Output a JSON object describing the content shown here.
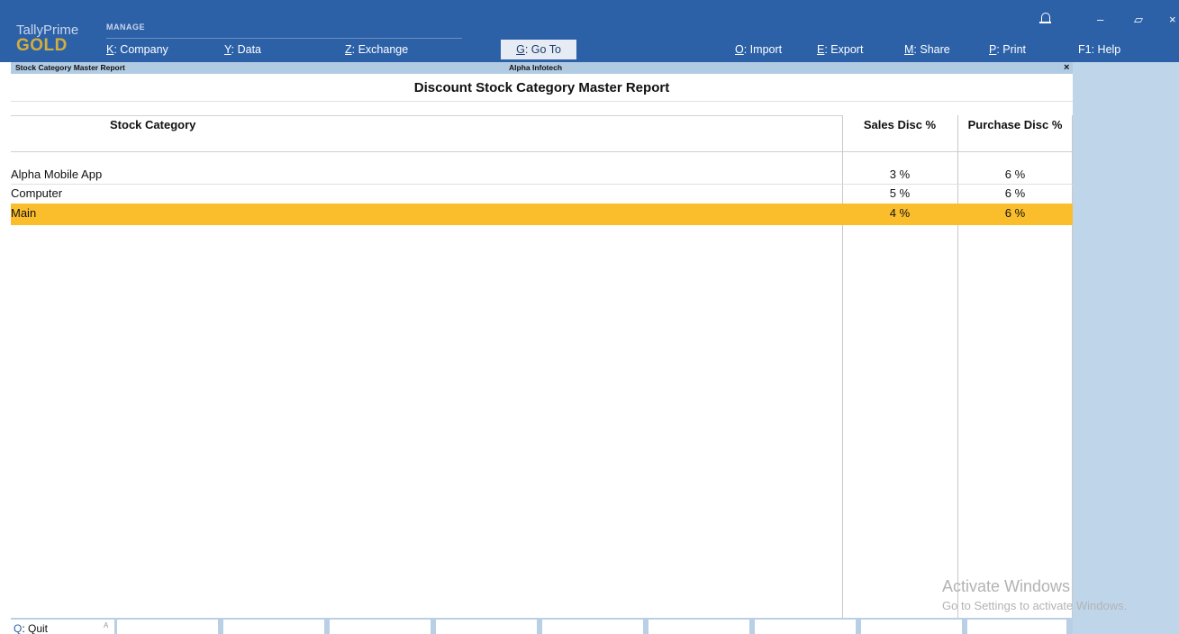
{
  "app": {
    "brand_top": "TallyPrime",
    "brand_bottom": "GOLD",
    "section": "MANAGE"
  },
  "menu": [
    {
      "key": "K",
      "label": ": Company"
    },
    {
      "key": "Y",
      "label": ": Data"
    },
    {
      "key": "Z",
      "label": ": Exchange"
    },
    {
      "key": "G",
      "label": ": Go To"
    },
    {
      "key": "O",
      "label": ": Import"
    },
    {
      "key": "E",
      "label": ": Export"
    },
    {
      "key": "M",
      "label": ": Share"
    },
    {
      "key": "P",
      "label": ": Print"
    },
    {
      "key": "F1",
      "label": ": Help"
    }
  ],
  "window_controls": {
    "minimize": "–",
    "restore": "▱",
    "close": "×"
  },
  "subbar": {
    "report_name": "Stock Category Master Report",
    "company": "Alpha Infotech",
    "close": "×"
  },
  "report": {
    "title": "Discount Stock Category Master Report",
    "columns": [
      "Stock Category",
      "Sales Disc %",
      "Purchase Disc %"
    ],
    "rows": [
      {
        "name": "Alpha Mobile App",
        "sales": "3 %",
        "purchase": "6 %"
      },
      {
        "name": "Computer",
        "sales": "5 %",
        "purchase": "6 %"
      },
      {
        "name": "Main",
        "sales": "4 %",
        "purchase": "6 %"
      }
    ],
    "selected_row": 2
  },
  "bottom": {
    "quit_key": "Q",
    "quit_label": ": Quit",
    "sep": "A"
  },
  "watermark": {
    "line1": "Activate Windows",
    "line2": "Go to Settings to activate Windows."
  },
  "colors": {
    "topbar": "#2c61a8",
    "subbar": "#b1cbe3",
    "selection": "#fabe2c",
    "brand_gold": "#d4ae3b"
  }
}
